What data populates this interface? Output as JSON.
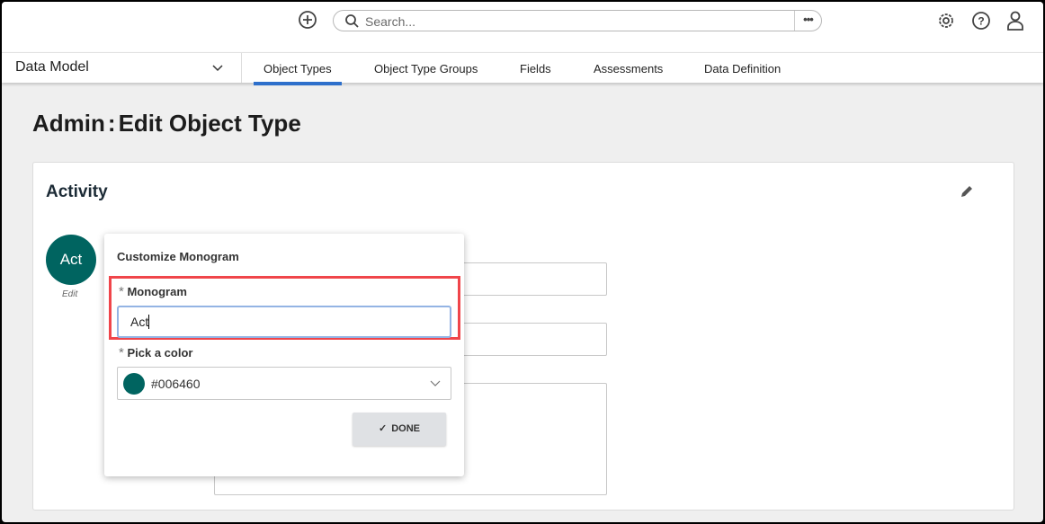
{
  "header": {
    "search_placeholder": "Search...",
    "more_label": "•••"
  },
  "nav": {
    "section": "Data Model",
    "tabs": [
      {
        "label": "Object Types",
        "active": true
      },
      {
        "label": "Object Type Groups"
      },
      {
        "label": "Fields"
      },
      {
        "label": "Assessments"
      },
      {
        "label": "Data Definition"
      }
    ]
  },
  "page": {
    "title_prefix": "Admin",
    "title_sep": ":",
    "title": "Edit Object Type"
  },
  "card": {
    "title": "Activity",
    "monogram": "Act",
    "edit_label": "Edit"
  },
  "popover": {
    "title": "Customize Monogram",
    "monogram_label": "Monogram",
    "monogram_value": "Act",
    "color_label": "Pick a color",
    "color_value": "#006460",
    "done_label": "DONE",
    "required_mark": "*"
  },
  "colors": {
    "accent": "#2d6fcb",
    "monogram": "#006460",
    "highlight": "#f0454a"
  }
}
